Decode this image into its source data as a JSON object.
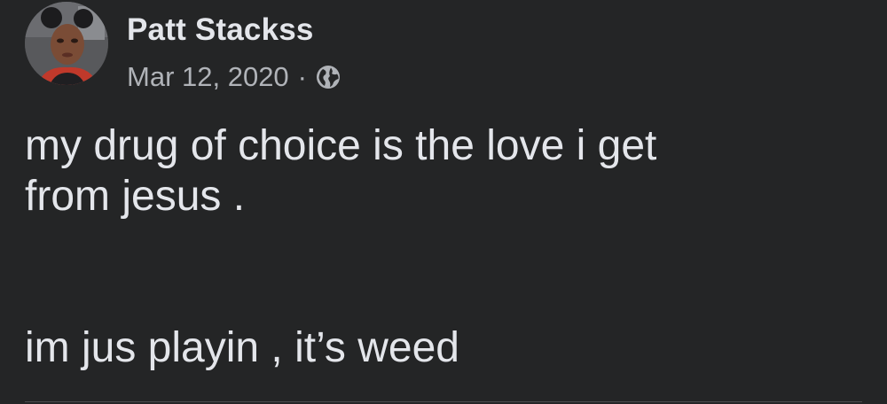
{
  "post": {
    "author": {
      "name": "Patt Stackss",
      "avatar_icon": "profile-photo"
    },
    "date": "Mar 12, 2020",
    "separator": "·",
    "audience_icon": "globe-icon",
    "lines": [
      "my drug of choice is the love i get",
      "from jesus .",
      "im jus playin , it’s weed"
    ]
  },
  "theme": {
    "background": "#242526",
    "primary_text": "#e4e6eb",
    "secondary_text": "#b0b3b8"
  }
}
